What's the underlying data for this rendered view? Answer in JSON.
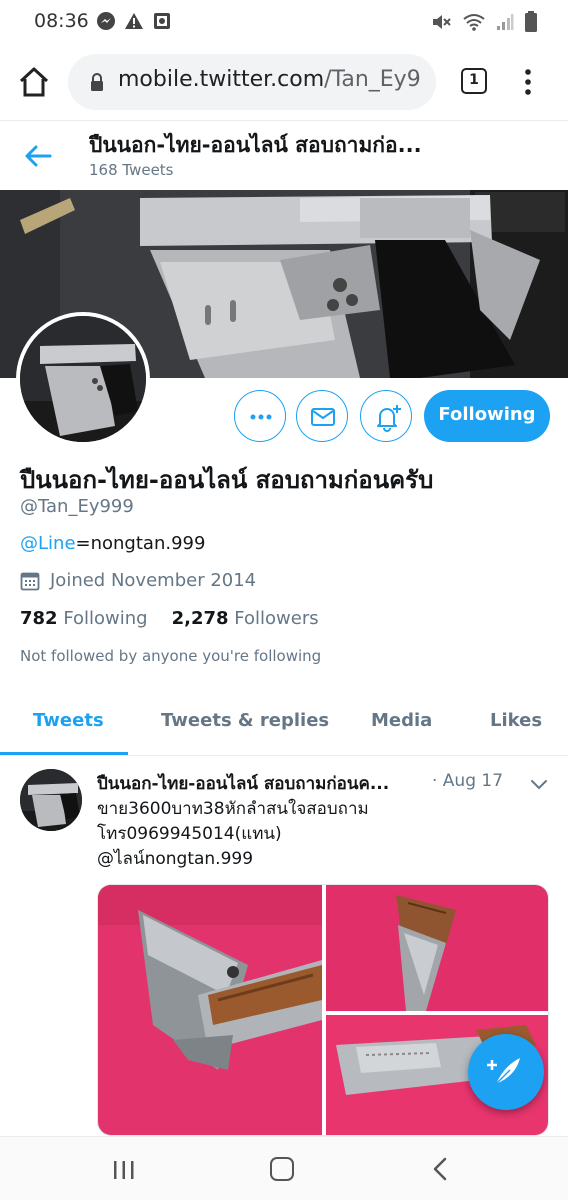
{
  "status_bar": {
    "time": "08:36",
    "left_icons": [
      "messenger-icon",
      "warning-icon",
      "photo-icon"
    ],
    "right_icons": [
      "mute-icon",
      "wifi-icon",
      "signal-icon",
      "battery-icon"
    ]
  },
  "browser": {
    "url_host": "mobile.twitter.com",
    "url_path": "/Tan_Ey9",
    "tab_count": "1"
  },
  "header": {
    "title": "ปืนนอก-ไทย-ออนไลน์ สอบถามก่อ...",
    "tweet_count": "168 Tweets"
  },
  "profile": {
    "follow_label": "Following",
    "name": "ปืนนอก-ไทย-ออนไลน์ สอบถามก่อนครับ",
    "handle": "@Tan_Ey999",
    "bio_mention": "@Line",
    "bio_rest": "=nongtan.999",
    "joined": "Joined November 2014",
    "following_count": "782",
    "following_label": "Following",
    "followers_count": "2,278",
    "followers_label": "Followers",
    "note": "Not followed by anyone you're following"
  },
  "tabs": [
    {
      "label": "Tweets",
      "active": true
    },
    {
      "label": "Tweets & replies",
      "active": false
    },
    {
      "label": "Media",
      "active": false
    },
    {
      "label": "Likes",
      "active": false
    }
  ],
  "tweet": {
    "author": "ปืนนอก-ไทย-ออนไลน์ สอบถามก่อนค...",
    "date": "· Aug 17",
    "line1": "ขาย3600บาท38หักลำสนใจสอบถาม",
    "line2": "โทร0969945014(แทน)",
    "line3": "@ไลน์nongtan.999"
  },
  "colors": {
    "accent": "#1da1f2",
    "muted": "#657786"
  }
}
